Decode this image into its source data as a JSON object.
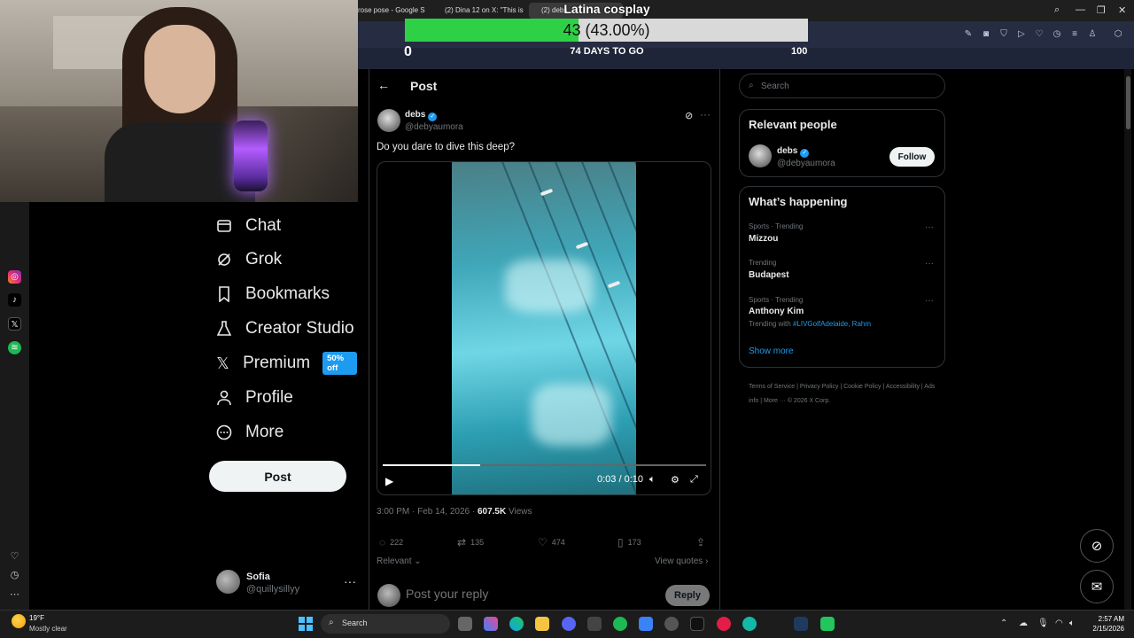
{
  "browser": {
    "tabs": [
      {
        "label": "rose pose - Google S"
      },
      {
        "label": "(2) Dina 12 on X: \"This is"
      },
      {
        "label": "(2) debs"
      }
    ]
  },
  "goal": {
    "title": "Latina cosplay",
    "count": "43 (43.00%)",
    "progress": 0.43,
    "min": "0",
    "days_left": "74 DAYS TO GO",
    "max": "100",
    "fill_color": "#2ed145"
  },
  "sidebar": {
    "items": [
      {
        "label": "Chat",
        "icon": "mail-icon"
      },
      {
        "label": "Grok",
        "icon": "grok-icon"
      },
      {
        "label": "Bookmarks",
        "icon": "bookmark-icon"
      },
      {
        "label": "Creator Studio",
        "icon": "flask-icon"
      },
      {
        "label": "Premium",
        "icon": "x-logo-icon",
        "badge": "50% off"
      },
      {
        "label": "Profile",
        "icon": "person-icon"
      },
      {
        "label": "More",
        "icon": "more-circle-icon"
      }
    ],
    "post_label": "Post",
    "account": {
      "name": "Sofia",
      "handle": "@quillysillyy"
    }
  },
  "post": {
    "header": "Post",
    "author": {
      "name": "debs",
      "handle": "@debyaumora"
    },
    "text": "Do you dare to dive this deep?",
    "video": {
      "time": "0:03 / 0:10",
      "progress": 0.3
    },
    "timestamp": "3:00 PM · Feb 14, 2026 · ",
    "views_count": "607.5K",
    "views_label": " Views",
    "stats": {
      "replies": "222",
      "reposts": "135",
      "likes": "474",
      "bookmarks": "173"
    },
    "relevant_label": "Relevant",
    "view_quotes_label": "View quotes",
    "reply_placeholder": "Post your reply",
    "reply_button": "Reply"
  },
  "right": {
    "search_placeholder": "Search",
    "relevant_people_title": "Relevant people",
    "person": {
      "name": "debs",
      "handle": "@debyaumora",
      "follow_label": "Follow"
    },
    "happening_title": "What’s happening",
    "trends": [
      {
        "context": "Sports · Trending",
        "name": "Mizzou"
      },
      {
        "context": "Trending",
        "name": "Budapest"
      },
      {
        "context": "Sports · Trending",
        "name": "Anthony Kim"
      }
    ],
    "trending_with_prefix": "Trending with ",
    "trending_with": "#LIVGolfAdelaide, Rahm",
    "show_more": "Show more",
    "footer": "Terms of Service  |  Privacy Policy  |  Cookie Policy  |  Accessibility  |  Ads info  |  More ···  © 2026 X Corp."
  },
  "taskbar": {
    "weather_temp": "19°F",
    "weather_desc": "Mostly clear",
    "search_label": "Search",
    "time": "2:57 AM",
    "date": "2/15/2026"
  }
}
